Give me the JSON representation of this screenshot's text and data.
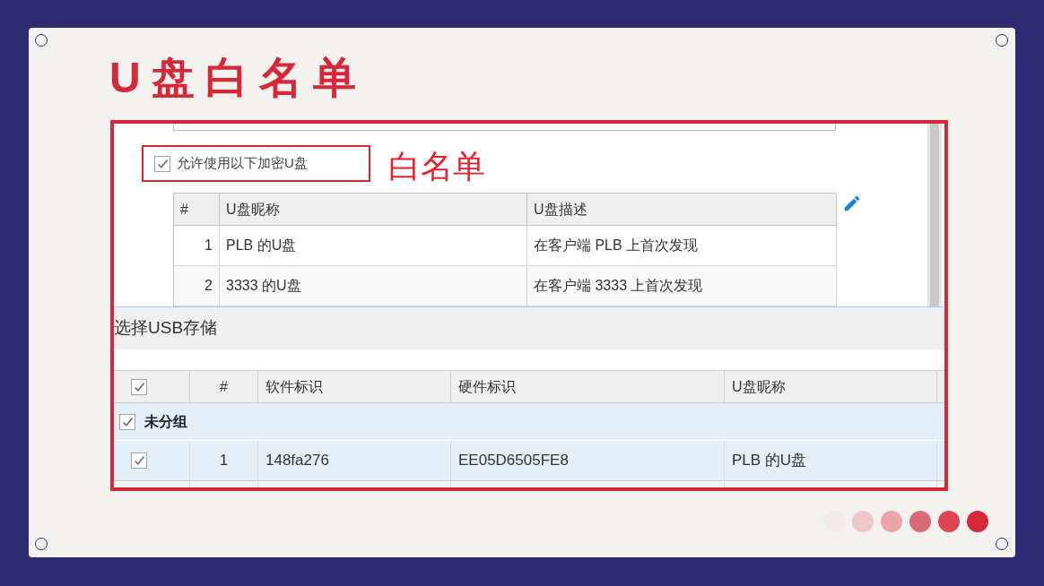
{
  "slide": {
    "title": "U盘白名单",
    "annotation": "白名单",
    "pager_dots": [
      {
        "color": "#f3ebe7"
      },
      {
        "color": "#efc5c7"
      },
      {
        "color": "#eba6aa"
      },
      {
        "color": "#db6a79"
      },
      {
        "color": "#dd4551"
      },
      {
        "color": "#d62839"
      }
    ]
  },
  "screenshot": {
    "whitelist": {
      "allow_option": {
        "label": "允许使用以下加密U盘",
        "checked": true
      },
      "table": {
        "columns": [
          "#",
          "U盘昵称",
          "U盘描述"
        ],
        "rows": [
          {
            "cells": [
              "1",
              "PLB 的U盘",
              "在客户端 PLB 上首次发现"
            ]
          },
          {
            "cells": [
              "2",
              "3333 的U盘",
              "在客户端 3333 上首次发现"
            ]
          }
        ]
      }
    },
    "usb_picker": {
      "title": "选择USB存储",
      "select_all_checked": true,
      "columns": [
        "#",
        "软件标识",
        "硬件标识",
        "U盘昵称"
      ],
      "groups": [
        {
          "name": "未分组",
          "checked": true,
          "rows": [
            {
              "checked": true,
              "cells": [
                "1",
                "148fa276",
                "EE05D6505FE8",
                "PLB 的U盘"
              ]
            }
          ]
        }
      ]
    }
  }
}
